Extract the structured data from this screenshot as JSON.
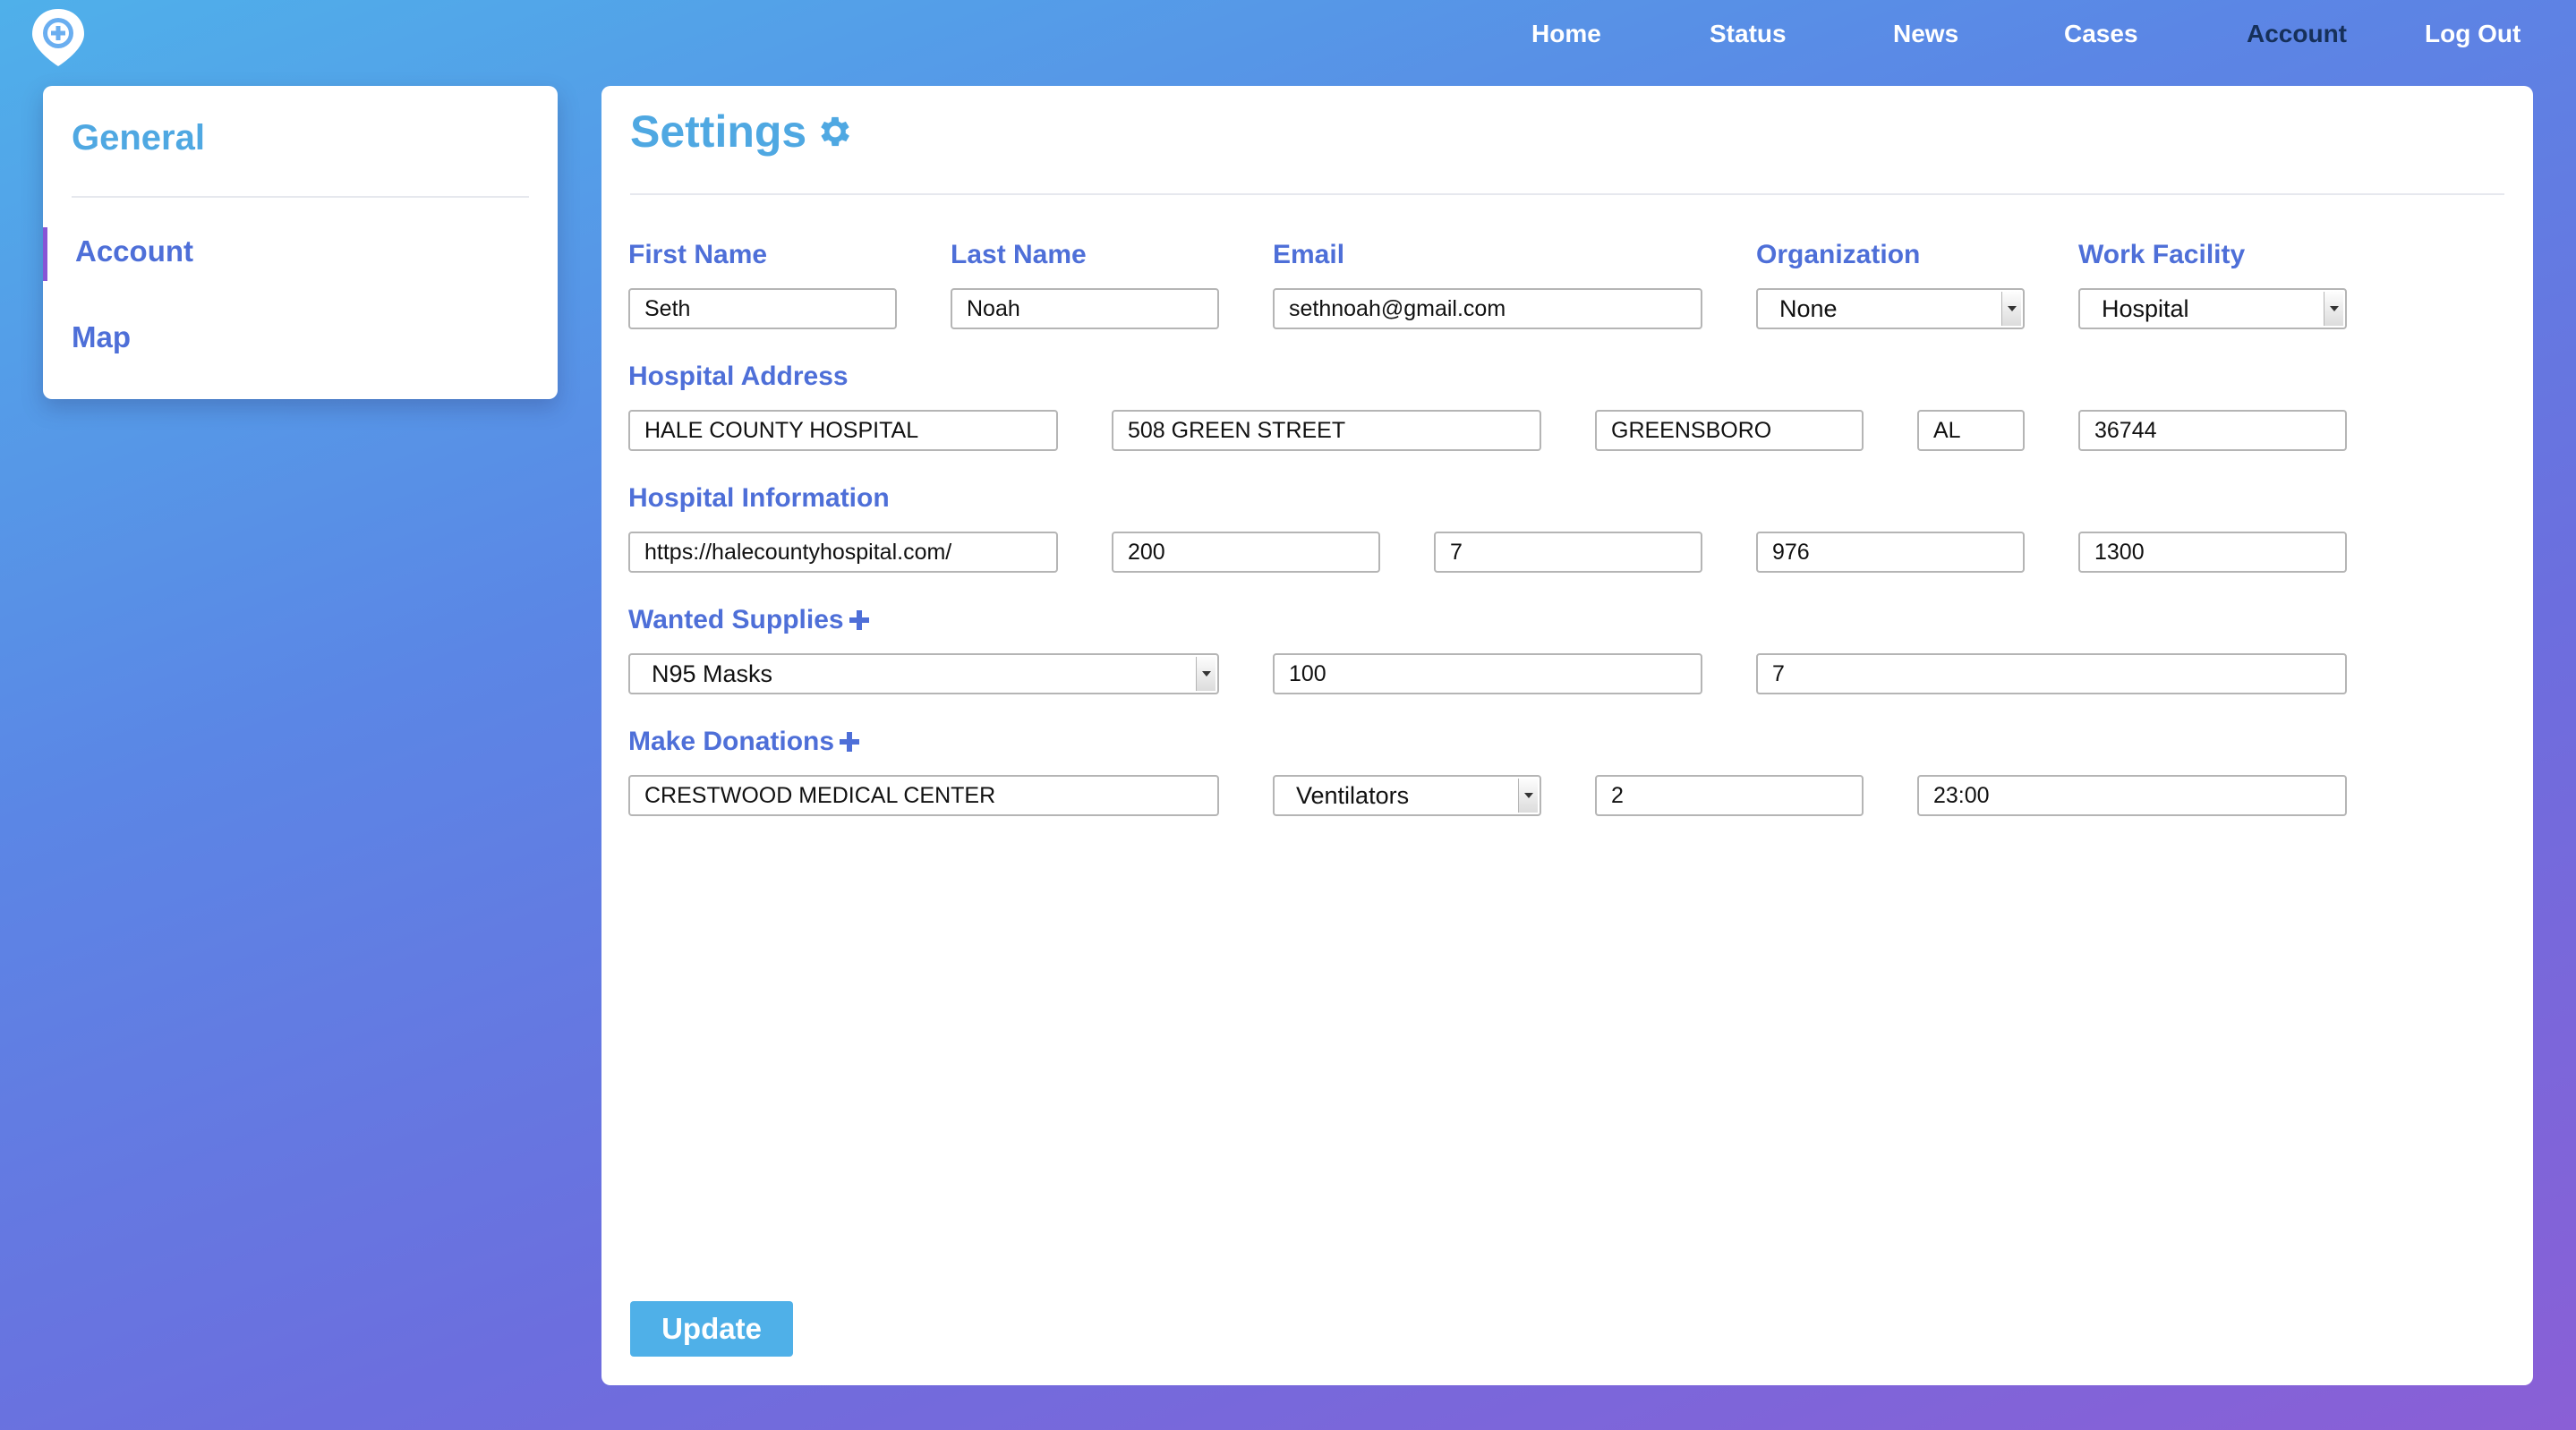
{
  "nav": {
    "items": [
      {
        "label": "Home"
      },
      {
        "label": "Status"
      },
      {
        "label": "News"
      },
      {
        "label": "Cases"
      },
      {
        "label": "Account"
      },
      {
        "label": "Log Out"
      }
    ],
    "active": "Account"
  },
  "sidebar": {
    "title": "General",
    "items": [
      {
        "label": "Account"
      },
      {
        "label": "Map"
      }
    ]
  },
  "settings": {
    "title": "Settings",
    "labels": {
      "first_name": "First Name",
      "last_name": "Last Name",
      "email": "Email",
      "organization": "Organization",
      "work_facility": "Work Facility",
      "hospital_address": "Hospital Address",
      "hospital_information": "Hospital Information",
      "wanted_supplies": "Wanted Supplies",
      "make_donations": "Make Donations"
    },
    "values": {
      "first_name": "Seth",
      "last_name": "Noah",
      "email": "sethnoah@gmail.com",
      "organization": "None",
      "work_facility": "Hospital",
      "address_name": "HALE COUNTY HOSPITAL",
      "address_street": "508 GREEN STREET",
      "address_city": "GREENSBORO",
      "address_state": "AL",
      "address_zip": "36744",
      "info_website": "https://halecountyhospital.com/",
      "info_1": "200",
      "info_2": "7",
      "info_3": "976",
      "info_4": "1300",
      "supply_item": "N95 Masks",
      "supply_quantity": "100",
      "supply_days": "7",
      "donation_recipient": "CRESTWOOD MEDICAL CENTER",
      "donation_item": "Ventilators",
      "donation_quantity": "2",
      "donation_time": "23:00"
    },
    "update_label": "Update"
  },
  "colors": {
    "accent": "#4fa8e2",
    "label": "#4e6fd8",
    "active_bar": "#8755d6",
    "button": "#4fb0e8"
  }
}
